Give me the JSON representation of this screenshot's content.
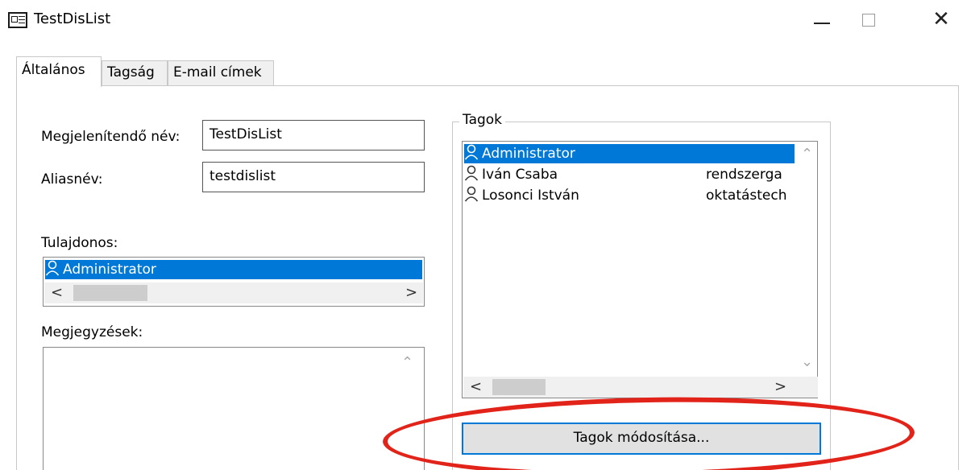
{
  "window": {
    "title": "TestDisList",
    "controls": {
      "minimize": "—",
      "maximize": "□",
      "close": "✕"
    }
  },
  "tabs": [
    {
      "label": "Általános",
      "active": true
    },
    {
      "label": "Tagság",
      "active": false
    },
    {
      "label": "E-mail címek",
      "active": false
    }
  ],
  "general": {
    "display_name_label": "Megjelenítendő név:",
    "display_name_value": "TestDisList",
    "alias_label": "Aliasnév:",
    "alias_value": "testdislist",
    "owner_label": "Tulajdonos:",
    "owner_items": [
      {
        "name": "Administrator",
        "selected": true
      }
    ],
    "notes_label": "Megjegyzések:",
    "notes_value": ""
  },
  "members": {
    "group_title": "Tagok",
    "rows": [
      {
        "name": "Administrator",
        "detail": "",
        "selected": true
      },
      {
        "name": "Iván Csaba",
        "detail": "rendszerga",
        "selected": false
      },
      {
        "name": "Losonci István",
        "detail": "oktatástech",
        "selected": false
      }
    ],
    "modify_button": "Tagok módosítása..."
  },
  "icons": {
    "app": "distribution-list-icon",
    "person": "person-icon",
    "arrow_left": "<",
    "arrow_right": ">",
    "arrow_up": "⌃",
    "arrow_down": "⌄"
  },
  "colors": {
    "selection": "#0078d7",
    "annotation": "#e2231a",
    "button_border": "#0078d7"
  }
}
